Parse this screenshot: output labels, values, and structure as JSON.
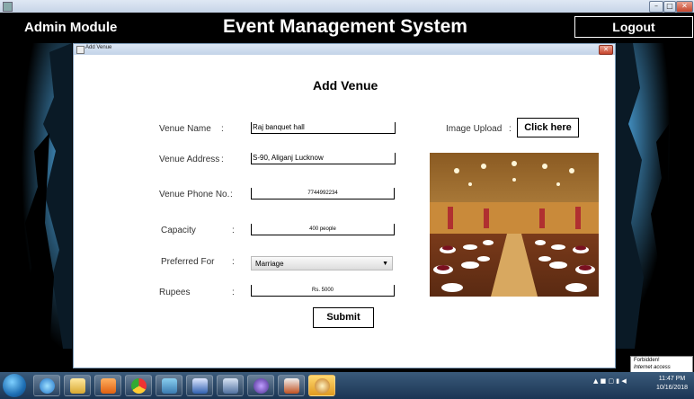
{
  "header": {
    "module_label": "Admin Module",
    "app_title": "Event Management System",
    "logout_label": "Logout"
  },
  "inner_window": {
    "title": "Add Venue"
  },
  "form": {
    "heading": "Add Venue",
    "venue_name": {
      "label": "Venue Name",
      "colon": ":",
      "value": "Raj banquet hall"
    },
    "venue_address": {
      "label": "Venue Address",
      "colon": ":",
      "value": "S-90, Aliganj Lucknow"
    },
    "venue_phone": {
      "label": "Venue Phone No.",
      "colon": ":",
      "value": "7744992234"
    },
    "capacity": {
      "label": "Capacity",
      "colon": ":",
      "value": "400 people"
    },
    "preferred_for": {
      "label": "Preferred For",
      "colon": ":",
      "selected": "Marriage"
    },
    "rupees": {
      "label": "Rupees",
      "colon": ":",
      "value": "Rs. 5000"
    },
    "image_upload": {
      "label": "Image Upload",
      "colon": ":",
      "button": "Click here"
    },
    "submit_label": "Submit"
  },
  "tray": {
    "forbidden_line1": "Forbidden!",
    "forbidden_line2": "Internet access",
    "time": "11:47 PM",
    "date": "10/16/2018"
  },
  "taskbar_icons": [
    "ie-icon",
    "explorer-icon",
    "media-player-icon",
    "chrome-icon",
    "photos-icon",
    "word-icon",
    "virtualbox-icon",
    "eclipse-icon",
    "java-icon",
    "network-globe-icon"
  ]
}
